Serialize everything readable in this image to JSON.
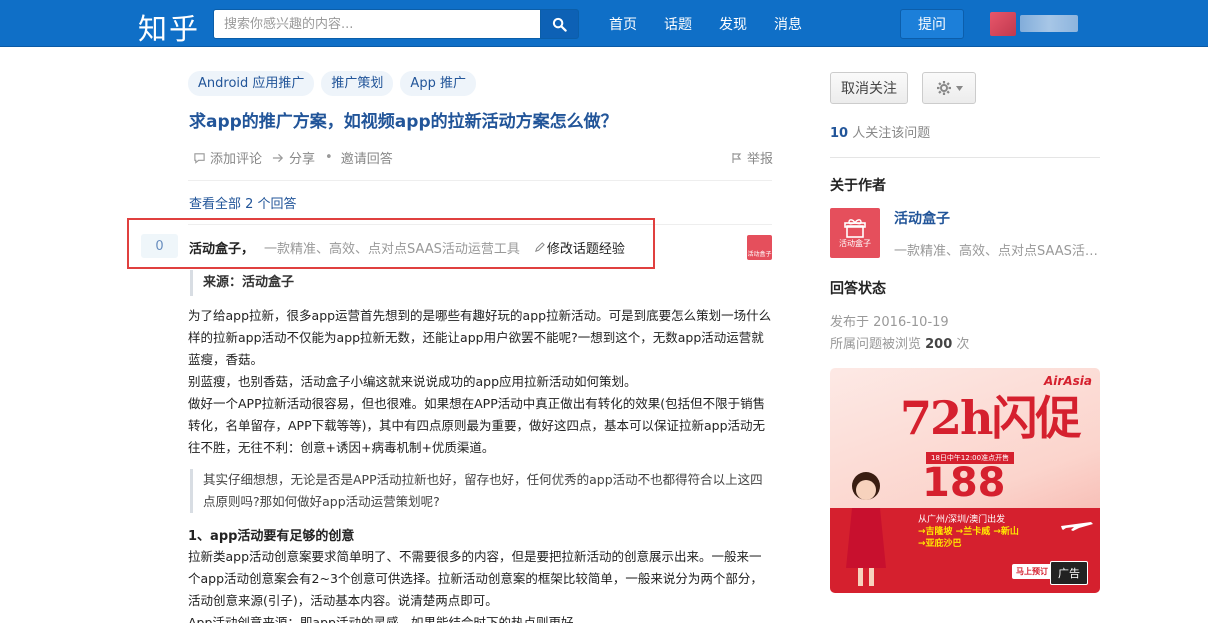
{
  "header": {
    "logo": "知乎",
    "search_placeholder": "搜索你感兴趣的内容...",
    "nav": [
      "首页",
      "话题",
      "发现",
      "消息"
    ],
    "ask_label": "提问"
  },
  "question": {
    "tags": [
      "Android 应用推广",
      "推广策划",
      "App 推广"
    ],
    "title": "求app的推广方案，如视频app的拉新活动方案怎么做？",
    "actions": {
      "comment": "添加评论",
      "share": "分享",
      "invite": "邀请回答",
      "report": "举报"
    },
    "view_all": "查看全部 2 个回答"
  },
  "answer": {
    "votes": "0",
    "author_name": "活动盒子，",
    "author_bio": "一款精准、高效、点对点SAAS活动运营工具",
    "edit_label": "修改话题经验",
    "avatar_text": "活动盒子",
    "source": "来源：活动盒子",
    "paragraph1": "为了给app拉新，很多app运营首先想到的是哪些有趣好玩的app拉新活动。可是到底要怎么策划一场什么样的拉新app活动不仅能为app拉新无数，还能让app用户欲罢不能呢?一想到这个，无数app活动运营就蓝瘦，香菇。",
    "paragraph2": "别蓝瘦，也别香菇，活动盒子小编这就来说说成功的app应用拉新活动如何策划。",
    "paragraph3": "做好一个APP拉新活动很容易，但也很难。如果想在APP活动中真正做出有转化的效果(包括但不限于销售转化，名单留存，APP下载等等)，其中有四点原则最为重要，做好这四点，基本可以保证拉新app活动无往不胜，无往不利：创意+诱因+病毒机制+优质渠道。",
    "quote": "其实仔细想想，无论是否是APP活动拉新也好，留存也好，任何优秀的app活动不也都得符合以上这四点原则吗?那如何做好app活动运营策划呢?",
    "section_heading": "1、app活动要有足够的创意",
    "paragraph4": "拉新类app活动创意案要求简单明了、不需要很多的内容，但是要把拉新活动的创意展示出来。一般来一个app活动创意案会有2~3个创意可供选择。拉新活动创意案的框架比较简单，一般来说分为两个部分，活动创意来源(引子)，活动基本内容。说清楚两点即可。",
    "paragraph5": "App活动创意来源：即app活动的灵感，如果能结合时下的热点则更好。"
  },
  "sidebar": {
    "unfollow_label": "取消关注",
    "followers_count": "10",
    "followers_text": " 人关注该问题",
    "about_heading": "关于作者",
    "author_name": "活动盒子",
    "author_bio": "一款精准、高效、点对点SAAS活动运营工具",
    "avatar_text": "活动盒子",
    "status_heading": "回答状态",
    "posted": "发布于 2016-10-19",
    "views_prefix": "所属问题被浏览 ",
    "views_count": "200",
    "views_suffix": " 次"
  },
  "ad": {
    "headline": "72h闪促",
    "brand": "AirAsia",
    "subline": "18日中午12:00准点开售",
    "price": "188",
    "route1": "从广州/深圳/澳门出发",
    "route2": "→吉隆坡 →兰卡威 →新山",
    "route3": "→亚庇沙巴",
    "cta": "马上预订",
    "tag": "广告"
  },
  "colors": {
    "header_bg": "#0f6fc7",
    "link": "#225599",
    "highlight_border": "#e0403f",
    "brand_red": "#e54f5c"
  }
}
